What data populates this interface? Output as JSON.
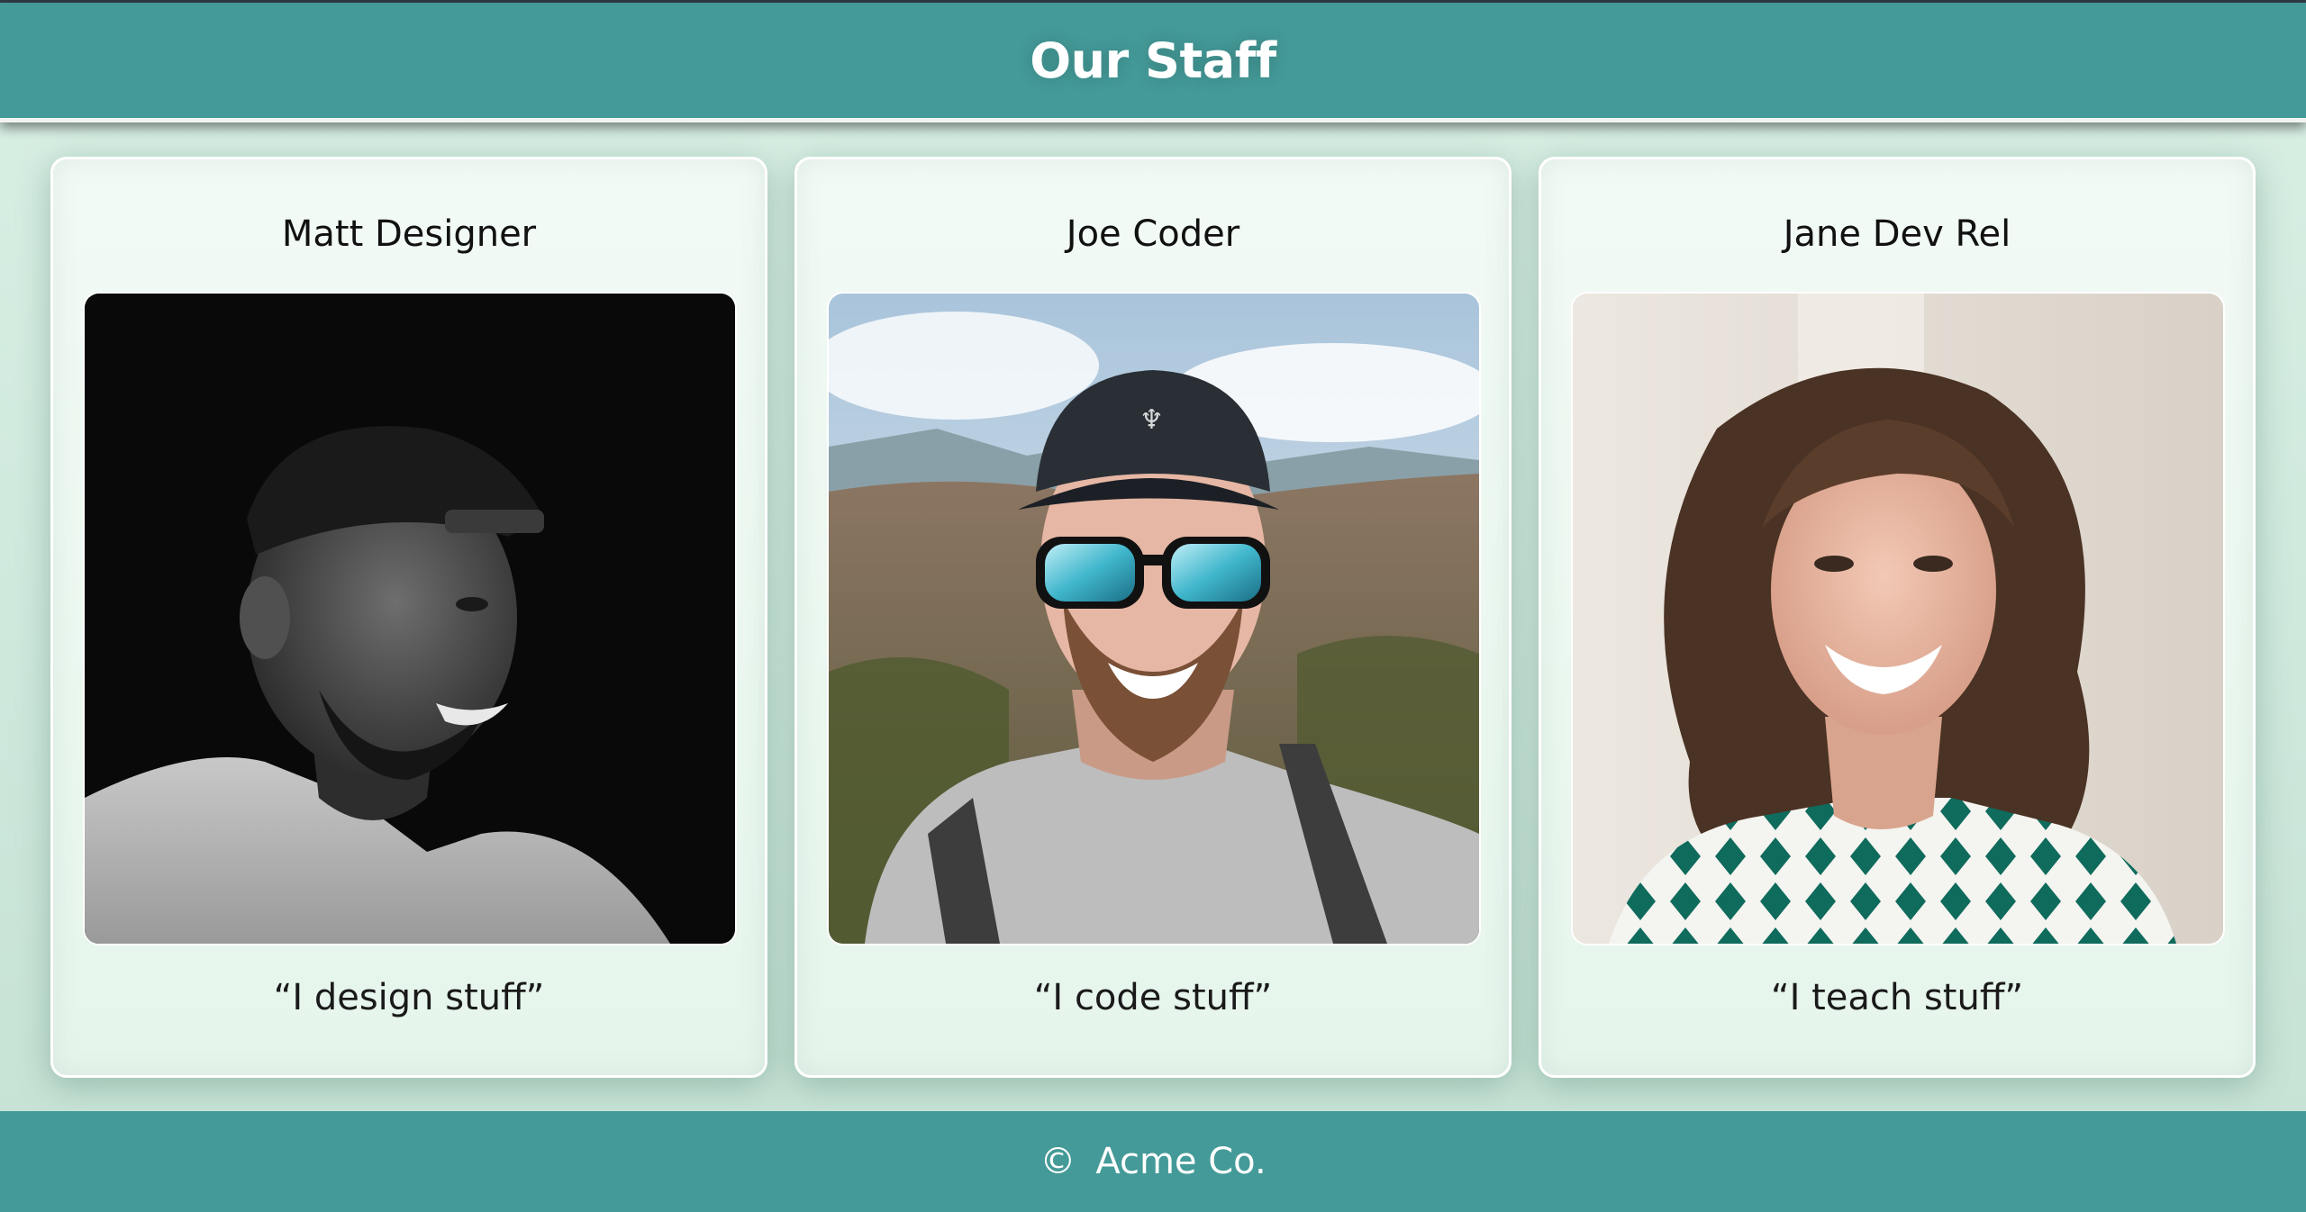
{
  "header": {
    "title": "Our Staff"
  },
  "staff": [
    {
      "name": "Matt Designer",
      "quote": "“I design stuff”",
      "photo": "black-and-white portrait of smiling man in backwards cap"
    },
    {
      "name": "Joe Coder",
      "quote": "“I code stuff”",
      "photo": "selfie of smiling man in cap and mirrored sunglasses in mountains"
    },
    {
      "name": "Jane Dev Rel",
      "quote": "“I teach stuff”",
      "photo": "portrait of smiling woman with wavy brown hair in patterned shirt"
    }
  ],
  "footer": {
    "copyright_symbol": "©",
    "company": "Acme Co."
  },
  "colors": {
    "header_bg": "#449a98",
    "footer_bg": "#449a98",
    "page_bg": "#d2ebdf",
    "card_bg": "#eef8f2"
  }
}
